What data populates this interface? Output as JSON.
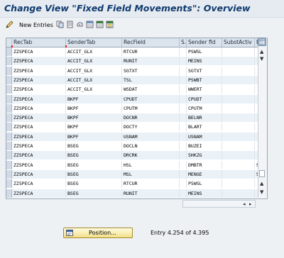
{
  "window": {
    "title": "Change View \"Fixed Field Movements\": Overview"
  },
  "toolbar": {
    "new_entries_label": "New Entries",
    "icons": [
      "edit-pencil-icon",
      "copy-icon",
      "delete-icon",
      "undo-icon",
      "select-all-icon",
      "deselect-icon",
      "select-block-icon"
    ]
  },
  "table": {
    "columns": [
      "RecTab",
      "SenderTab",
      "RecField",
      "S.",
      "Sender fld",
      "SubstActiv",
      "Ex"
    ],
    "rows": [
      {
        "rectab": "ZZSPECA",
        "sendtab": "ACCIT_GLX",
        "recfield": "RTCUR",
        "s": "",
        "sfld": "PSWSL",
        "subst": "",
        "ex": ""
      },
      {
        "rectab": "ZZSPECA",
        "sendtab": "ACCIT_GLX",
        "recfield": "RUNIT",
        "s": "",
        "sfld": "MEINS",
        "subst": "",
        "ex": ""
      },
      {
        "rectab": "ZZSPECA",
        "sendtab": "ACCIT_GLX",
        "recfield": "SGTXT",
        "s": "",
        "sfld": "SGTXT",
        "subst": "",
        "ex": ""
      },
      {
        "rectab": "ZZSPECA",
        "sendtab": "ACCIT_GLX",
        "recfield": "TSL",
        "s": "",
        "sfld": "PSWBT",
        "subst": "",
        "ex": ""
      },
      {
        "rectab": "ZZSPECA",
        "sendtab": "ACCIT_GLX",
        "recfield": "WSDAT",
        "s": "",
        "sfld": "WWERT",
        "subst": "",
        "ex": ""
      },
      {
        "rectab": "ZZSPECA",
        "sendtab": "BKPF",
        "recfield": "CPUDT",
        "s": "",
        "sfld": "CPUDT",
        "subst": "",
        "ex": ""
      },
      {
        "rectab": "ZZSPECA",
        "sendtab": "BKPF",
        "recfield": "CPUTM",
        "s": "",
        "sfld": "CPUTM",
        "subst": "",
        "ex": ""
      },
      {
        "rectab": "ZZSPECA",
        "sendtab": "BKPF",
        "recfield": "DOCNR",
        "s": "",
        "sfld": "BELNR",
        "subst": "",
        "ex": ""
      },
      {
        "rectab": "ZZSPECA",
        "sendtab": "BKPF",
        "recfield": "DOCTY",
        "s": "",
        "sfld": "BLART",
        "subst": "",
        "ex": ""
      },
      {
        "rectab": "ZZSPECA",
        "sendtab": "BKPF",
        "recfield": "USNAM",
        "s": "",
        "sfld": "USNAM",
        "subst": "",
        "ex": ""
      },
      {
        "rectab": "ZZSPECA",
        "sendtab": "BSEG",
        "recfield": "DOCLN",
        "s": "",
        "sfld": "BUZEI",
        "subst": "",
        "ex": ""
      },
      {
        "rectab": "ZZSPECA",
        "sendtab": "BSEG",
        "recfield": "DRCRK",
        "s": "",
        "sfld": "SHKZG",
        "subst": "",
        "ex": ""
      },
      {
        "rectab": "ZZSPECA",
        "sendtab": "BSEG",
        "recfield": "HSL",
        "s": "",
        "sfld": "DMBTR",
        "subst": "",
        "ex": "SO"
      },
      {
        "rectab": "ZZSPECA",
        "sendtab": "BSEG",
        "recfield": "MSL",
        "s": "",
        "sfld": "MENGE",
        "subst": "",
        "ex": "SO"
      },
      {
        "rectab": "ZZSPECA",
        "sendtab": "BSEG",
        "recfield": "RTCUR",
        "s": "",
        "sfld": "PSWSL",
        "subst": "",
        "ex": ""
      },
      {
        "rectab": "ZZSPECA",
        "sendtab": "BSEG",
        "recfield": "RUNIT",
        "s": "",
        "sfld": "MEINS",
        "subst": "",
        "ex": ""
      }
    ]
  },
  "footer": {
    "position_label": "Position...",
    "entry_text": "Entry 4.254 of 4.395"
  },
  "colors": {
    "title": "#0f3a6e",
    "header_bg": "#dbe3ec",
    "row_alt": "#eaf1f7",
    "button_bg": "#f3e08a"
  }
}
